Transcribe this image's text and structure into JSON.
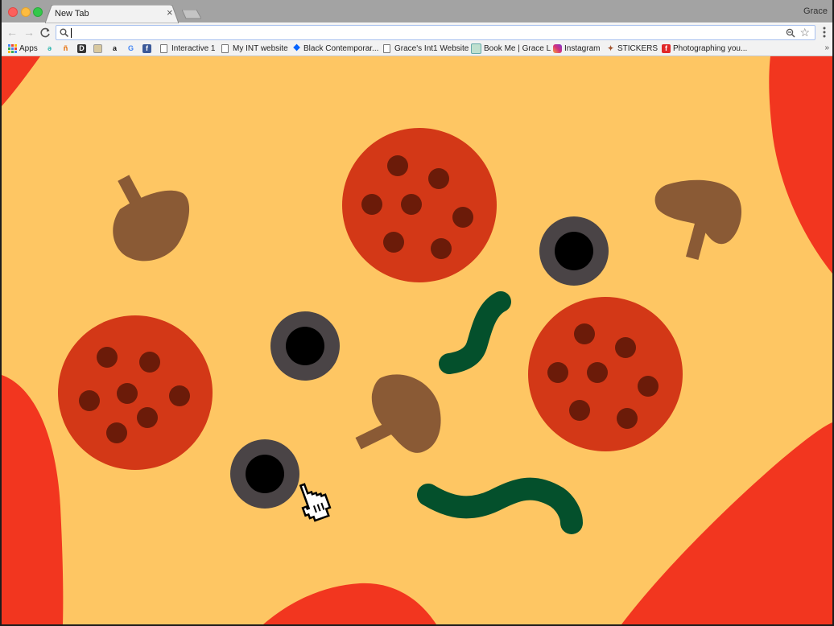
{
  "window": {
    "tab_title": "New Tab",
    "tab_close": "×",
    "profile_name": "Grace"
  },
  "toolbar": {
    "back": "←",
    "forward": "→",
    "reload": "C",
    "omnibox_value": "",
    "star": "☆"
  },
  "bookmarks": {
    "apps_label": "Apps",
    "items": [
      {
        "label": "Interactive 1",
        "icon": "page-icon"
      },
      {
        "label": "My INT website",
        "icon": "page-icon"
      },
      {
        "label": "Black Contemporar...",
        "icon": "dropbox-icon"
      },
      {
        "label": "Grace's Int1 Website",
        "icon": "page-icon"
      },
      {
        "label": "Book Me | Grace L",
        "icon": "site-icon"
      },
      {
        "label": "Instagram",
        "icon": "instagram-icon"
      },
      {
        "label": "STICKERS",
        "icon": "sticker-icon"
      },
      {
        "label": "Photographing you...",
        "icon": "flipboard-icon"
      }
    ],
    "more": "»"
  },
  "colors": {
    "crust": "#fec663",
    "sauce": "#f2361f",
    "pepperoni": "#d33817",
    "pepperoni_spot": "#6b1b09",
    "olive": "#4a4446",
    "mushroom": "#8a5a35",
    "pepper": "#04502c"
  }
}
